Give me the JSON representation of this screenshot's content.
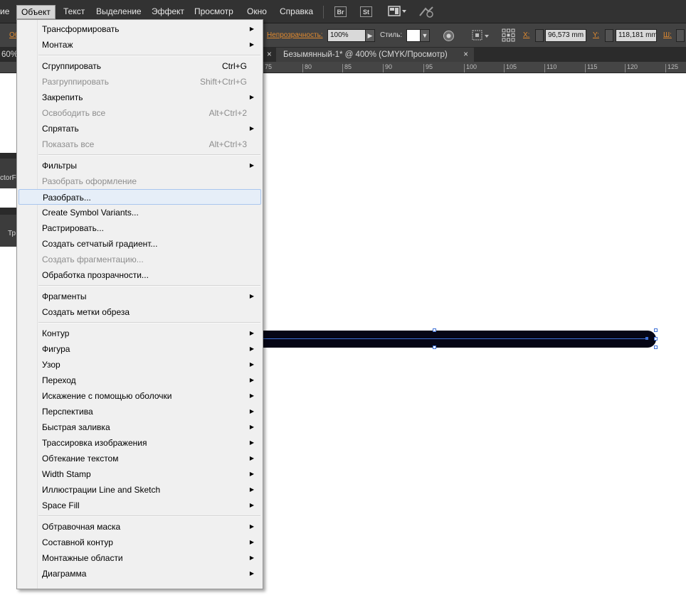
{
  "menubar": {
    "items": [
      "ие",
      "Объект",
      "Текст",
      "Выделение",
      "Эффект",
      "Просмотр",
      "Окно",
      "Справка"
    ],
    "bridge_label": "Br",
    "stock_label": "St"
  },
  "controlbar": {
    "left_fragment": "Об",
    "opacity_label": "Непрозрачность:",
    "opacity_value": "100%",
    "style_label": "Стиль:",
    "x_label": "X:",
    "x_value": "96,573 mm",
    "y_label": "Y:",
    "y_value": "118,181 mm",
    "w_label": "Ш:"
  },
  "document_tabs": {
    "partial_tab": "60%",
    "active_tab": "Безымянный-1* @ 400% (CMYK/Просмотр)",
    "close_symbol": "×"
  },
  "ruler": {
    "ticks": [
      "75",
      "80",
      "85",
      "90",
      "95",
      "100",
      "105",
      "110",
      "115",
      "120",
      "125"
    ]
  },
  "side_panels": {
    "panel1_label": "ctorFi",
    "panel2_label": "Тр"
  },
  "menu": {
    "items": [
      {
        "label": "Трансформировать",
        "shortcut": "",
        "submenu": true,
        "disabled": false,
        "highlight": false
      },
      {
        "label": "Монтаж",
        "shortcut": "",
        "submenu": true,
        "disabled": false,
        "highlight": false
      },
      {
        "separator": true
      },
      {
        "label": "Сгруппировать",
        "shortcut": "Ctrl+G",
        "submenu": false,
        "disabled": false,
        "highlight": false
      },
      {
        "label": "Разгруппировать",
        "shortcut": "Shift+Ctrl+G",
        "submenu": false,
        "disabled": true,
        "highlight": false
      },
      {
        "label": "Закрепить",
        "shortcut": "",
        "submenu": true,
        "disabled": false,
        "highlight": false
      },
      {
        "label": "Освободить все",
        "shortcut": "Alt+Ctrl+2",
        "submenu": false,
        "disabled": true,
        "highlight": false
      },
      {
        "label": "Спрятать",
        "shortcut": "",
        "submenu": true,
        "disabled": false,
        "highlight": false
      },
      {
        "label": "Показать все",
        "shortcut": "Alt+Ctrl+3",
        "submenu": false,
        "disabled": true,
        "highlight": false
      },
      {
        "separator": true
      },
      {
        "label": "Фильтры",
        "shortcut": "",
        "submenu": true,
        "disabled": false,
        "highlight": false
      },
      {
        "label": "Разобрать оформление",
        "shortcut": "",
        "submenu": false,
        "disabled": true,
        "highlight": false
      },
      {
        "label": "Разобрать...",
        "shortcut": "",
        "submenu": false,
        "disabled": false,
        "highlight": true
      },
      {
        "label": "Create Symbol Variants...",
        "shortcut": "",
        "submenu": false,
        "disabled": false,
        "highlight": false
      },
      {
        "label": "Растрировать...",
        "shortcut": "",
        "submenu": false,
        "disabled": false,
        "highlight": false
      },
      {
        "label": "Создать сетчатый градиент...",
        "shortcut": "",
        "submenu": false,
        "disabled": false,
        "highlight": false
      },
      {
        "label": "Создать фрагментацию...",
        "shortcut": "",
        "submenu": false,
        "disabled": true,
        "highlight": false
      },
      {
        "label": "Обработка прозрачности...",
        "shortcut": "",
        "submenu": false,
        "disabled": false,
        "highlight": false
      },
      {
        "separator": true
      },
      {
        "label": "Фрагменты",
        "shortcut": "",
        "submenu": true,
        "disabled": false,
        "highlight": false
      },
      {
        "label": "Создать метки обреза",
        "shortcut": "",
        "submenu": false,
        "disabled": false,
        "highlight": false
      },
      {
        "separator": true
      },
      {
        "label": "Контур",
        "shortcut": "",
        "submenu": true,
        "disabled": false,
        "highlight": false
      },
      {
        "label": "Фигура",
        "shortcut": "",
        "submenu": true,
        "disabled": false,
        "highlight": false
      },
      {
        "label": "Узор",
        "shortcut": "",
        "submenu": true,
        "disabled": false,
        "highlight": false
      },
      {
        "label": "Переход",
        "shortcut": "",
        "submenu": true,
        "disabled": false,
        "highlight": false
      },
      {
        "label": "Искажение с помощью оболочки",
        "shortcut": "",
        "submenu": true,
        "disabled": false,
        "highlight": false
      },
      {
        "label": "Перспектива",
        "shortcut": "",
        "submenu": true,
        "disabled": false,
        "highlight": false
      },
      {
        "label": "Быстрая заливка",
        "shortcut": "",
        "submenu": true,
        "disabled": false,
        "highlight": false
      },
      {
        "label": "Трассировка изображения",
        "shortcut": "",
        "submenu": true,
        "disabled": false,
        "highlight": false
      },
      {
        "label": "Обтекание текстом",
        "shortcut": "",
        "submenu": true,
        "disabled": false,
        "highlight": false
      },
      {
        "label": "Width Stamp",
        "shortcut": "",
        "submenu": true,
        "disabled": false,
        "highlight": false
      },
      {
        "label": "Иллюстрации Line and Sketch",
        "shortcut": "",
        "submenu": true,
        "disabled": false,
        "highlight": false
      },
      {
        "label": "Space Fill",
        "shortcut": "",
        "submenu": true,
        "disabled": false,
        "highlight": false
      },
      {
        "separator": true
      },
      {
        "label": "Обтравочная маска",
        "shortcut": "",
        "submenu": true,
        "disabled": false,
        "highlight": false
      },
      {
        "label": "Составной контур",
        "shortcut": "",
        "submenu": true,
        "disabled": false,
        "highlight": false
      },
      {
        "label": "Монтажные области",
        "shortcut": "",
        "submenu": true,
        "disabled": false,
        "highlight": false
      },
      {
        "label": "Диаграмма",
        "shortcut": "",
        "submenu": true,
        "disabled": false,
        "highlight": false
      }
    ]
  }
}
